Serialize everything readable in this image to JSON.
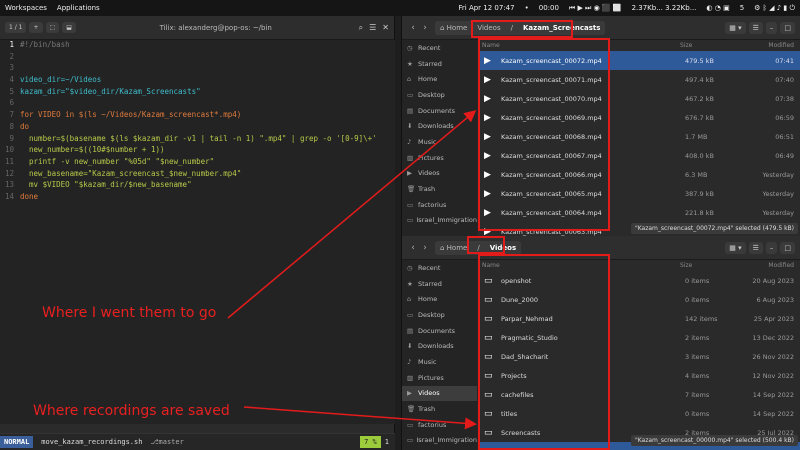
{
  "topbar": {
    "workspaces": "Workspaces",
    "applications": "Applications",
    "clock": "Fri Apr 12  07:47",
    "dot": "•",
    "counter": "00:00",
    "net": "2.37Kb... 3.22Kb...",
    "workspace_num": "5"
  },
  "terminal": {
    "tabcount": "1 / 1",
    "title": "Tilix: alexanderg@pop-os: ~/bin",
    "lines": [
      {
        "n": "1",
        "t": "#!/bin/bash",
        "cls": "cm"
      },
      {
        "n": "2",
        "t": "",
        "cls": ""
      },
      {
        "n": "3",
        "t": "",
        "cls": ""
      },
      {
        "n": "4",
        "t": "video_dir=~/Videos",
        "cls": "var"
      },
      {
        "n": "5",
        "t": "kazam_dir=\"$video_dir/Kazam_Screencasts\"",
        "cls": "var"
      },
      {
        "n": "6",
        "t": "",
        "cls": ""
      },
      {
        "n": "7",
        "t": "for VIDEO in $(ls ~/Videos/Kazam_screencast*.mp4)",
        "cls": "kw"
      },
      {
        "n": "8",
        "t": "do",
        "cls": "kw"
      },
      {
        "n": "9",
        "t": "  number=$(basename $(ls $kazam_dir -v1 | tail -n 1) \".mp4\" | grep -o '[0-9]\\+'",
        "cls": "str"
      },
      {
        "n": "10",
        "t": "  new_number=$((10#$number + 1))",
        "cls": "str"
      },
      {
        "n": "11",
        "t": "  printf -v new_number \"%05d\" \"$new_number\"",
        "cls": "str"
      },
      {
        "n": "12",
        "t": "  new_basename=\"Kazam_screencast_$new_number.mp4\"",
        "cls": "str"
      },
      {
        "n": "13",
        "t": "  mv $VIDEO \"$kazam_dir/$new_basename\"",
        "cls": "str"
      },
      {
        "n": "14",
        "t": "done",
        "cls": "kw"
      }
    ],
    "mode": "NORMAL",
    "file": "move_kazam_recordings.sh",
    "branch": "master",
    "pct": "7 %",
    "pos": "1"
  },
  "fm_top": {
    "crumb1": "Home",
    "crumb2": "Videos",
    "crumb3": "Kazam_Screencasts",
    "sidebar": [
      "Recent",
      "Starred",
      "Home",
      "Desktop",
      "Documents",
      "Downloads",
      "Music",
      "Pictures",
      "Videos",
      "Trash",
      "factorius",
      "Israel_Immigration"
    ],
    "cols": {
      "name": "Name",
      "size": "Size",
      "modified": "Modified"
    },
    "rows": [
      {
        "name": "Kazam_screencast_00072.mp4",
        "size": "479.5 kB",
        "mod": "07:41"
      },
      {
        "name": "Kazam_screencast_00071.mp4",
        "size": "497.4 kB",
        "mod": "07:40"
      },
      {
        "name": "Kazam_screencast_00070.mp4",
        "size": "467.2 kB",
        "mod": "07:38"
      },
      {
        "name": "Kazam_screencast_00069.mp4",
        "size": "676.7 kB",
        "mod": "06:59"
      },
      {
        "name": "Kazam_screencast_00068.mp4",
        "size": "1.7 MB",
        "mod": "06:51"
      },
      {
        "name": "Kazam_screencast_00067.mp4",
        "size": "408.0 kB",
        "mod": "06:49"
      },
      {
        "name": "Kazam_screencast_00066.mp4",
        "size": "6.3 MB",
        "mod": "Yesterday"
      },
      {
        "name": "Kazam_screencast_00065.mp4",
        "size": "387.9 kB",
        "mod": "Yesterday"
      },
      {
        "name": "Kazam_screencast_00064.mp4",
        "size": "221.8 kB",
        "mod": "Yesterday"
      },
      {
        "name": "Kazam_screencast_00063.mp4",
        "size": "",
        "mod": ""
      }
    ],
    "status": "\"Kazam_screencast_00072.mp4\" selected (479.5 kB)"
  },
  "fm_bot": {
    "crumb1": "Home",
    "crumb2": "Videos",
    "sidebar": [
      "Recent",
      "Starred",
      "Home",
      "Desktop",
      "Documents",
      "Downloads",
      "Music",
      "Pictures",
      "Videos",
      "Trash",
      "factorius",
      "Israel_Immigration"
    ],
    "cols": {
      "name": "Name",
      "size": "Size",
      "modified": "Modified"
    },
    "rows": [
      {
        "name": "openshot",
        "size": "0 items",
        "mod": "20 Aug 2023",
        "ic": "folder"
      },
      {
        "name": "Dune_2000",
        "size": "0 items",
        "mod": "6 Aug 2023",
        "ic": "folder"
      },
      {
        "name": "Parpar_Nehmad",
        "size": "142 items",
        "mod": "25 Apr 2023",
        "ic": "folder"
      },
      {
        "name": "Pragmatic_Studio",
        "size": "2 items",
        "mod": "13 Dec 2022",
        "ic": "folder"
      },
      {
        "name": "Dad_Shacharit",
        "size": "3 items",
        "mod": "26 Nov 2022",
        "ic": "folder"
      },
      {
        "name": "Projects",
        "size": "4 items",
        "mod": "12 Nov 2022",
        "ic": "folder"
      },
      {
        "name": "cachefiles",
        "size": "7 items",
        "mod": "14 Sep 2022",
        "ic": "folder"
      },
      {
        "name": "titles",
        "size": "0 items",
        "mod": "14 Sep 2022",
        "ic": "folder"
      },
      {
        "name": "Screencasts",
        "size": "2 items",
        "mod": "25 Jul 2022",
        "ic": "folder"
      },
      {
        "name": "Kazam_screencast_00000.mp4",
        "size": "",
        "mod": "",
        "ic": "video"
      }
    ],
    "status": "\"Kazam_screencast_00000.mp4\" selected (500.4 kB)"
  },
  "annotations": {
    "went": "Where I went them to go",
    "saved": "Where recordings are saved"
  },
  "colors": {
    "annotation": "#e31b1b",
    "selection": "#2e5a9a"
  }
}
